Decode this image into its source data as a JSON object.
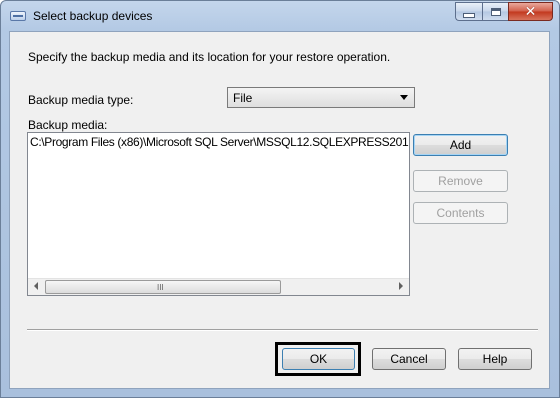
{
  "window": {
    "title": "Select backup devices",
    "icon": "dialog-window-icon"
  },
  "caption_buttons": [
    "minimize-icon",
    "maximize-icon",
    "close-icon"
  ],
  "instruction": "Specify the backup media and its location for your restore operation.",
  "media_type": {
    "label": "Backup media type:",
    "selected": "File"
  },
  "backup_media": {
    "label": "Backup media:",
    "items": [
      "C:\\Program Files (x86)\\Microsoft SQL Server\\MSSQL12.SQLEXPRESS201"
    ],
    "scrollbar_grip": "III"
  },
  "side_buttons": {
    "add": "Add",
    "remove": "Remove",
    "contents": "Contents"
  },
  "footer_buttons": {
    "ok": "OK",
    "cancel": "Cancel",
    "help": "Help"
  }
}
